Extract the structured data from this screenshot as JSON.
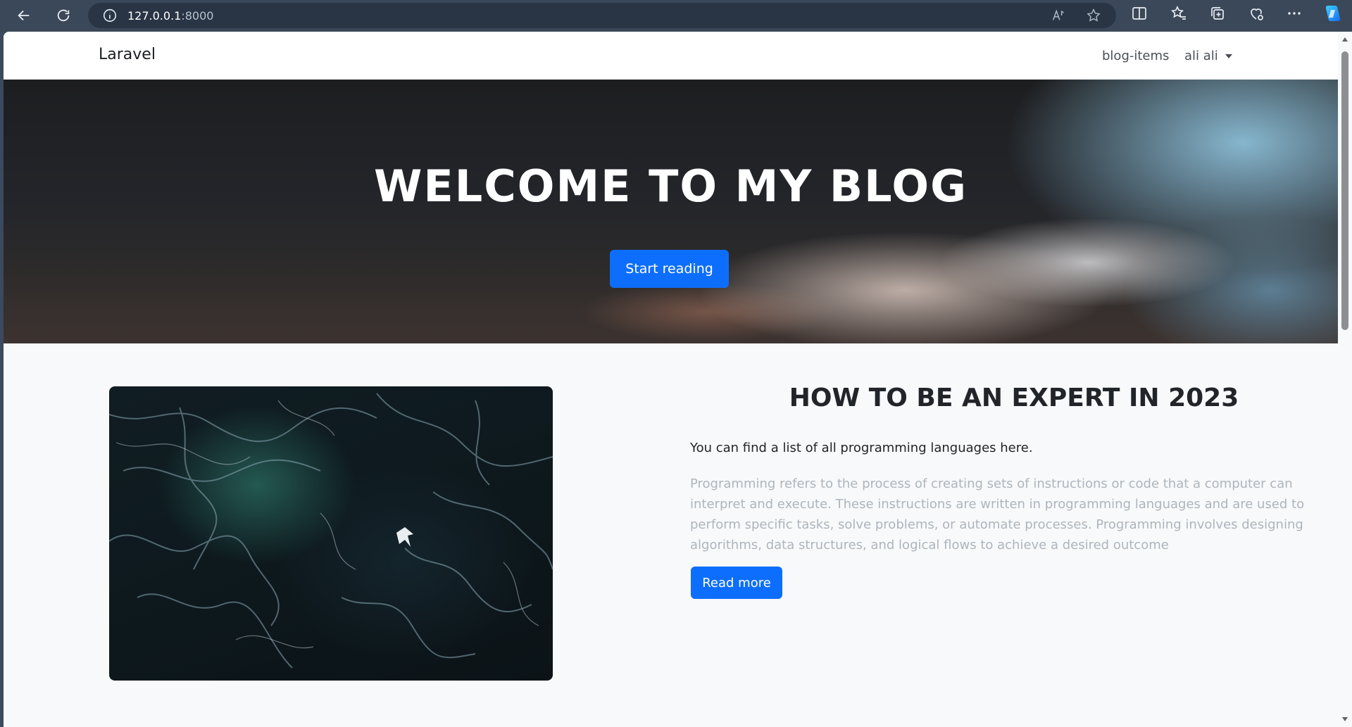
{
  "browser": {
    "url_host": "127.0.0.1",
    "url_port": ":8000"
  },
  "navbar": {
    "brand": "Laravel",
    "blog_link": "blog-items",
    "user_menu": "ali ali"
  },
  "hero": {
    "title": "WELCOME TO MY BLOG",
    "button": "Start reading"
  },
  "post": {
    "title": "HOW TO BE AN EXPERT IN 2023",
    "subtitle": "You can find a list of all programming languages here.",
    "body": "Programming refers to the process of creating sets of instructions or code that a computer can interpret and execute. These instructions are written in programming languages and are used to perform specific tasks, solve problems, or automate processes. Programming involves designing algorithms, data structures, and logical flows to achieve a desired outcome",
    "button": "Read more"
  },
  "colors": {
    "primary": "#0d6efd",
    "page_bg": "#f8f9fa",
    "muted_text": "#adb5bd"
  }
}
